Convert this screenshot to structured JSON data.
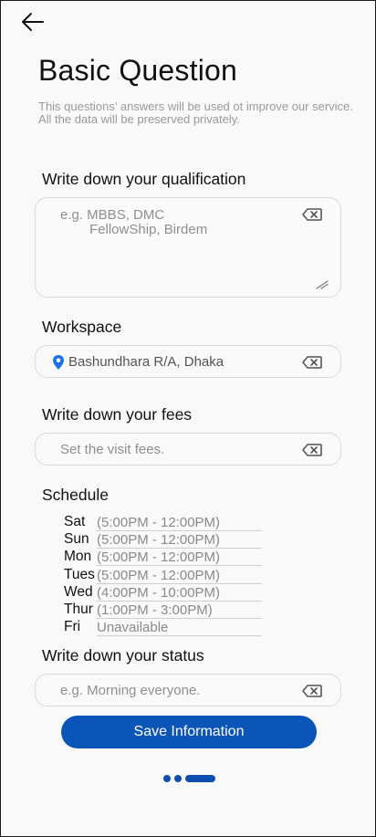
{
  "page": {
    "title": "Basic Question",
    "subtitle": "This questions’ answers will be used ot improve our service. All the data will be preserved privately."
  },
  "qualification": {
    "label": "Write down your qualification",
    "placeholder_line1": "e.g. MBBS, DMC",
    "placeholder_line2": "FellowShip, Birdem"
  },
  "workspace": {
    "label": "Workspace",
    "value": "Bashundhara R/A, Dhaka"
  },
  "fees": {
    "label": "Write down your fees",
    "placeholder": "Set the visit fees."
  },
  "schedule": {
    "label": "Schedule",
    "rows": [
      {
        "day": "Sat",
        "time": "(5:00PM - 12:00PM)"
      },
      {
        "day": "Sun",
        "time": "(5:00PM - 12:00PM)"
      },
      {
        "day": "Mon",
        "time": "(5:00PM - 12:00PM)"
      },
      {
        "day": "Tues",
        "time": "(5:00PM - 12:00PM)"
      },
      {
        "day": "Wed",
        "time": "(4:00PM - 10:00PM)"
      },
      {
        "day": "Thur",
        "time": "(1:00PM - 3:00PM)"
      },
      {
        "day": "Fri",
        "time": "Unavailable"
      }
    ]
  },
  "status": {
    "label": "Write down your status",
    "placeholder": "e.g. Morning everyone."
  },
  "actions": {
    "save_label": "Save Information"
  },
  "colors": {
    "primary": "#0c55b8",
    "pin": "#1a73e8"
  },
  "pagination": {
    "total_steps": 3,
    "current_step": 3
  }
}
